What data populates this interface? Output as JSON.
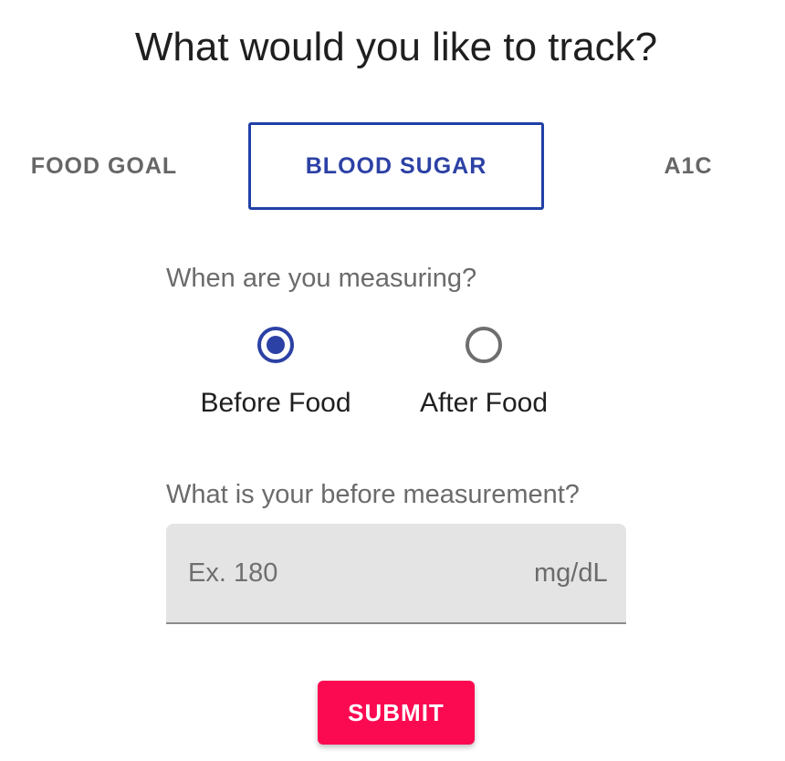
{
  "header": {
    "title": "What would you like to track?"
  },
  "tabs": [
    {
      "label": "FOOD GOAL",
      "selected": false
    },
    {
      "label": "BLOOD SUGAR",
      "selected": true
    },
    {
      "label": "A1C",
      "selected": false
    }
  ],
  "timing": {
    "question": "When are you measuring?",
    "options": [
      {
        "label": "Before Food",
        "checked": true
      },
      {
        "label": "After Food",
        "checked": false
      }
    ]
  },
  "measurement": {
    "question": "What is your before measurement?",
    "placeholder": "Ex. 180",
    "value": "",
    "unit": "mg/dL"
  },
  "actions": {
    "submit_label": "SUBMIT"
  },
  "colors": {
    "accent": "#2c41a5",
    "submit": "#fb0a52",
    "input_bg": "#e4e4e4"
  }
}
